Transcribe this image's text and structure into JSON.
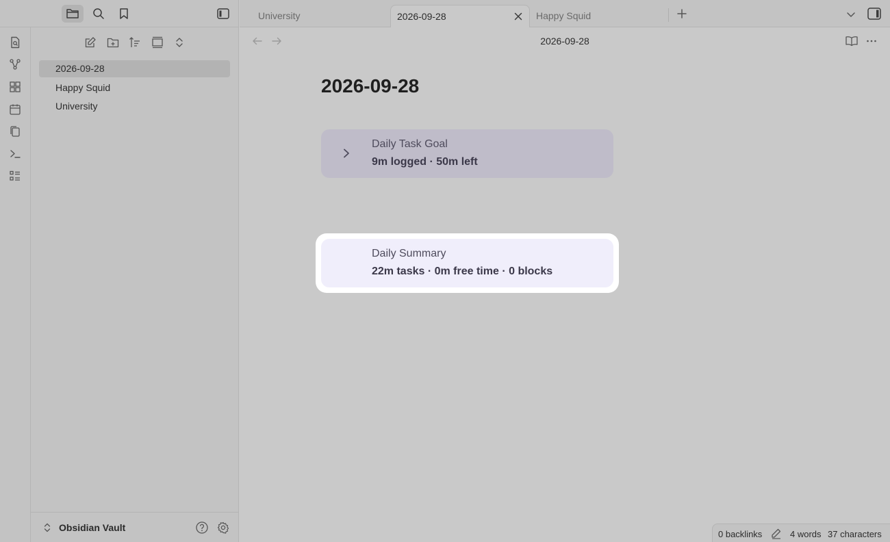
{
  "tabs": {
    "items": [
      {
        "title": "University"
      },
      {
        "title": "2026-09-28"
      },
      {
        "title": "Happy Squid"
      }
    ]
  },
  "sidebar": {
    "files": [
      "2026-09-28",
      "Happy Squid",
      "University"
    ],
    "vault_name": "Obsidian Vault"
  },
  "view": {
    "header_title": "2026-09-28",
    "note_title": "2026-09-28"
  },
  "cards": {
    "goal": {
      "label": "Daily Task Goal",
      "value": "9m logged · 50m left"
    },
    "summary": {
      "label": "Daily Summary",
      "value": "22m tasks · 0m free time · 0 blocks"
    }
  },
  "status": {
    "backlinks": "0 backlinks",
    "words": "4 words",
    "characters": "37 characters"
  },
  "colors": {
    "accent_card": "#bfbcc9",
    "highlight_card": "#f0eefb"
  }
}
